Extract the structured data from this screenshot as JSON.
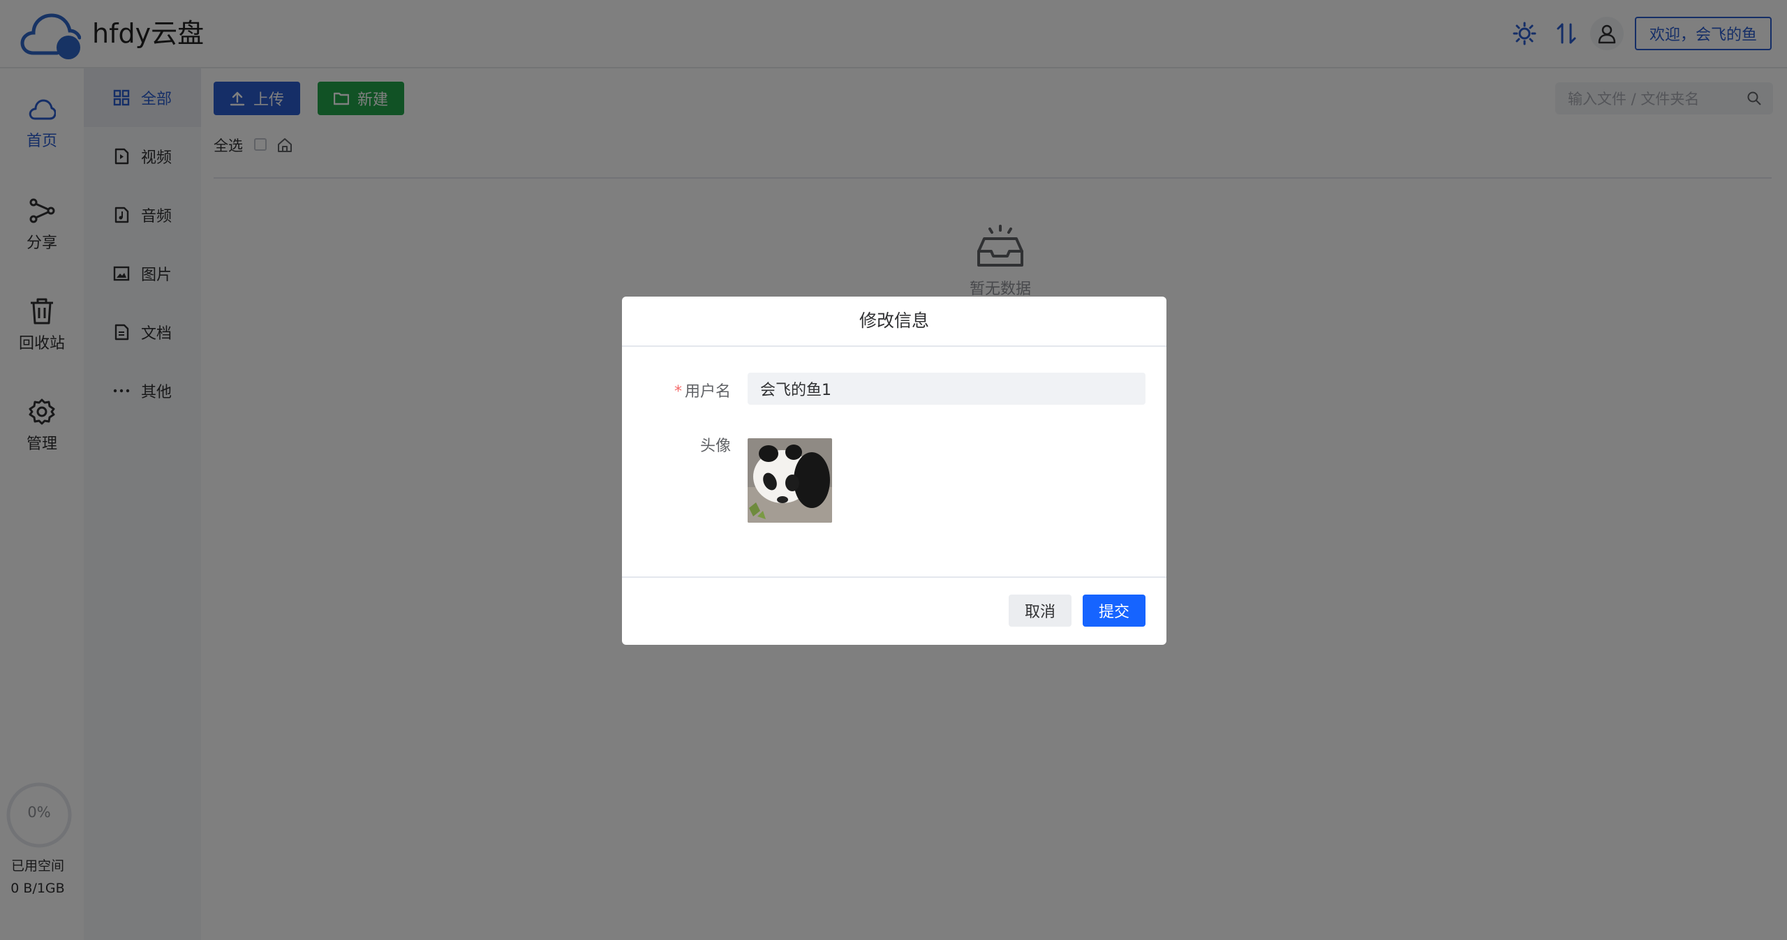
{
  "app": {
    "title": "hfdy云盘"
  },
  "header": {
    "welcome_text": "欢迎，会飞的鱼",
    "icons": [
      "sun-icon",
      "transfer-icon",
      "user-icon"
    ]
  },
  "rail": {
    "items": [
      {
        "label": "首页",
        "icon": "cloud-icon",
        "active": true
      },
      {
        "label": "分享",
        "icon": "share-icon",
        "active": false
      },
      {
        "label": "回收站",
        "icon": "trash-icon",
        "active": false
      },
      {
        "label": "管理",
        "icon": "gear-icon",
        "active": false
      }
    ]
  },
  "subnav": {
    "items": [
      {
        "label": "全部",
        "icon": "grid-icon",
        "active": true
      },
      {
        "label": "视频",
        "icon": "video-file-icon"
      },
      {
        "label": "音频",
        "icon": "audio-file-icon"
      },
      {
        "label": "图片",
        "icon": "image-file-icon"
      },
      {
        "label": "文档",
        "icon": "document-icon"
      },
      {
        "label": "其他",
        "icon": "more-icon"
      }
    ]
  },
  "toolbar": {
    "upload_label": "上传",
    "new_label": "新建",
    "search_placeholder": "输入文件 / 文件夹名"
  },
  "file_list": {
    "select_all_label": "全选",
    "empty_text": "暂无数据"
  },
  "storage": {
    "percent_text": "0%",
    "percent_value": 0,
    "label": "已用空间",
    "value": "0 B/1GB"
  },
  "dialog": {
    "title": "修改信息",
    "username_label": "用户名",
    "username_value": "会飞的鱼1",
    "avatar_label": "头像",
    "cancel_label": "取消",
    "submit_label": "提交"
  },
  "colors": {
    "primary": "#2b5ccf",
    "success": "#22a54b",
    "submit": "#1664ff",
    "required": "#f56c6c"
  }
}
